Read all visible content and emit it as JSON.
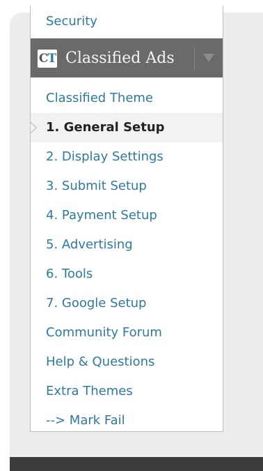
{
  "top_item": {
    "label": "Security"
  },
  "header": {
    "logo_c": "C",
    "logo_t": "T",
    "title": "Classified Ads"
  },
  "colors": {
    "link": "#2e7aa0",
    "active_text": "#222222",
    "header_bg": "#6a6a6a"
  },
  "menu": {
    "items": [
      {
        "label": "Classified Theme"
      },
      {
        "label": "1. General Setup",
        "active": true
      },
      {
        "label": "2. Display Settings"
      },
      {
        "label": "3. Submit Setup"
      },
      {
        "label": "4. Payment Setup"
      },
      {
        "label": "5. Advertising"
      },
      {
        "label": "6. Tools"
      },
      {
        "label": "7. Google Setup"
      },
      {
        "label": "Community Forum"
      },
      {
        "label": "Help & Questions"
      },
      {
        "label": "Extra Themes"
      },
      {
        "label": "--> Mark Fail"
      }
    ]
  }
}
